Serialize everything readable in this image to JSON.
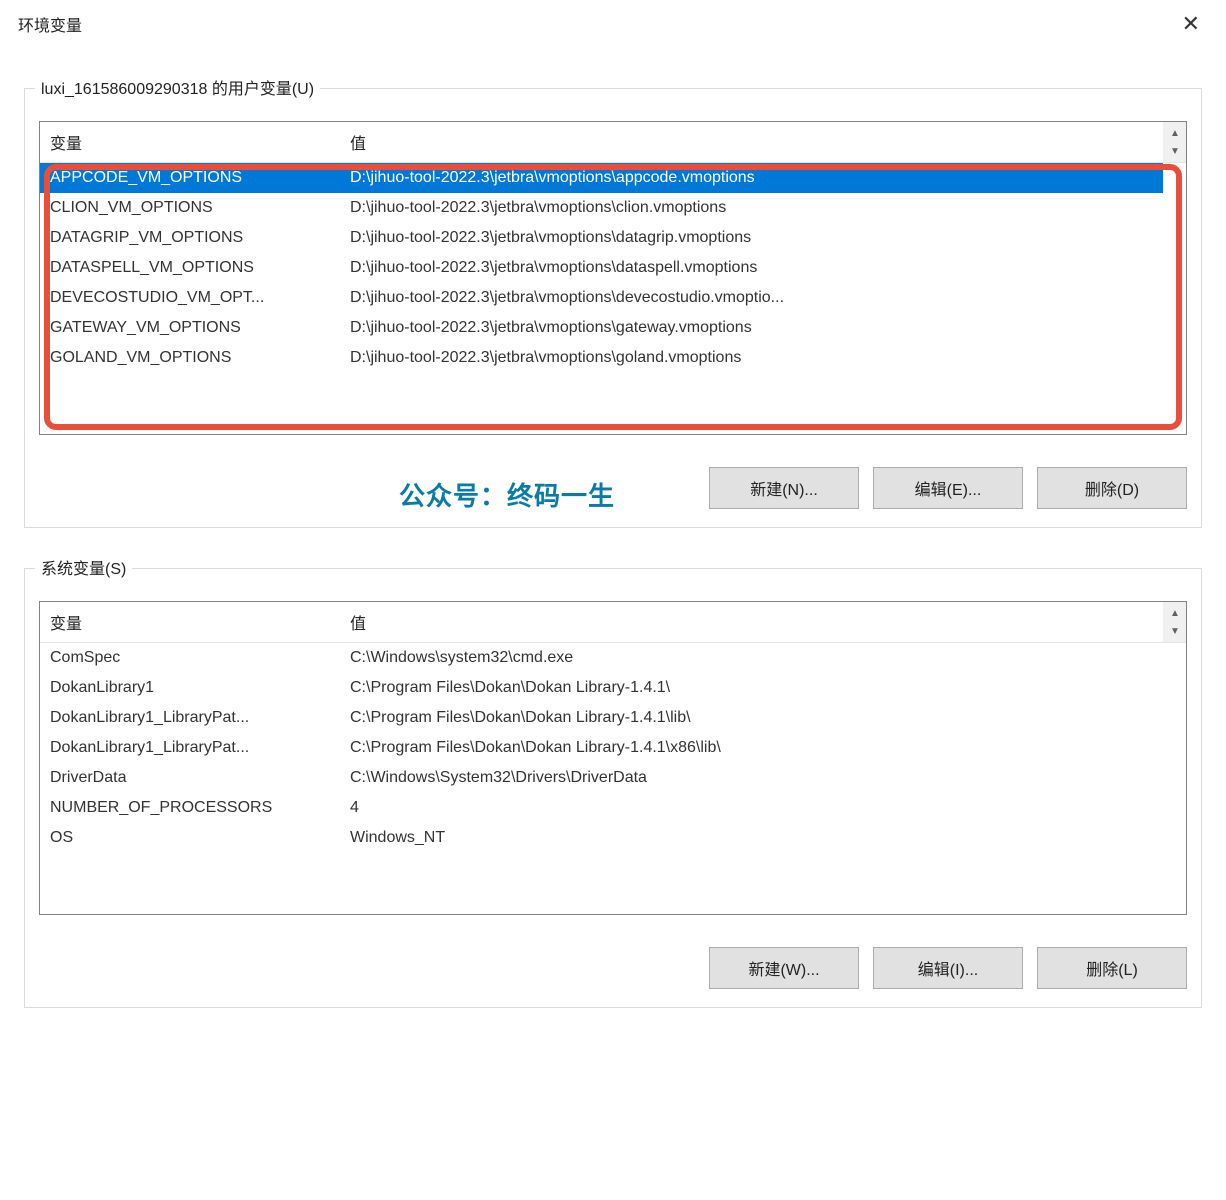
{
  "window": {
    "title": "环境变量"
  },
  "watermark": {
    "left": "公众号：",
    "right": "终码一生"
  },
  "user_vars": {
    "legend": "luxi_161586009290318 的用户变量(U)",
    "columns": {
      "name": "变量",
      "value": "值"
    },
    "rows": [
      {
        "name": "APPCODE_VM_OPTIONS",
        "value": "D:\\jihuo-tool-2022.3\\jetbra\\vmoptions\\appcode.vmoptions",
        "selected": true
      },
      {
        "name": "CLION_VM_OPTIONS",
        "value": "D:\\jihuo-tool-2022.3\\jetbra\\vmoptions\\clion.vmoptions"
      },
      {
        "name": "DATAGRIP_VM_OPTIONS",
        "value": "D:\\jihuo-tool-2022.3\\jetbra\\vmoptions\\datagrip.vmoptions"
      },
      {
        "name": "DATASPELL_VM_OPTIONS",
        "value": "D:\\jihuo-tool-2022.3\\jetbra\\vmoptions\\dataspell.vmoptions"
      },
      {
        "name": "DEVECOSTUDIO_VM_OPT...",
        "value": "D:\\jihuo-tool-2022.3\\jetbra\\vmoptions\\devecostudio.vmoptio..."
      },
      {
        "name": "GATEWAY_VM_OPTIONS",
        "value": "D:\\jihuo-tool-2022.3\\jetbra\\vmoptions\\gateway.vmoptions"
      },
      {
        "name": "GOLAND_VM_OPTIONS",
        "value": "D:\\jihuo-tool-2022.3\\jetbra\\vmoptions\\goland.vmoptions"
      }
    ],
    "buttons": {
      "new": "新建(N)...",
      "edit": "编辑(E)...",
      "delete": "删除(D)"
    }
  },
  "system_vars": {
    "legend": "系统变量(S)",
    "columns": {
      "name": "变量",
      "value": "值"
    },
    "rows": [
      {
        "name": "ComSpec",
        "value": "C:\\Windows\\system32\\cmd.exe"
      },
      {
        "name": "DokanLibrary1",
        "value": "C:\\Program Files\\Dokan\\Dokan Library-1.4.1\\"
      },
      {
        "name": "DokanLibrary1_LibraryPat...",
        "value": "C:\\Program Files\\Dokan\\Dokan Library-1.4.1\\lib\\"
      },
      {
        "name": "DokanLibrary1_LibraryPat...",
        "value": "C:\\Program Files\\Dokan\\Dokan Library-1.4.1\\x86\\lib\\"
      },
      {
        "name": "DriverData",
        "value": "C:\\Windows\\System32\\Drivers\\DriverData"
      },
      {
        "name": "NUMBER_OF_PROCESSORS",
        "value": "4"
      },
      {
        "name": "OS",
        "value": "Windows_NT"
      }
    ],
    "buttons": {
      "new": "新建(W)...",
      "edit": "编辑(I)...",
      "delete": "删除(L)"
    }
  }
}
